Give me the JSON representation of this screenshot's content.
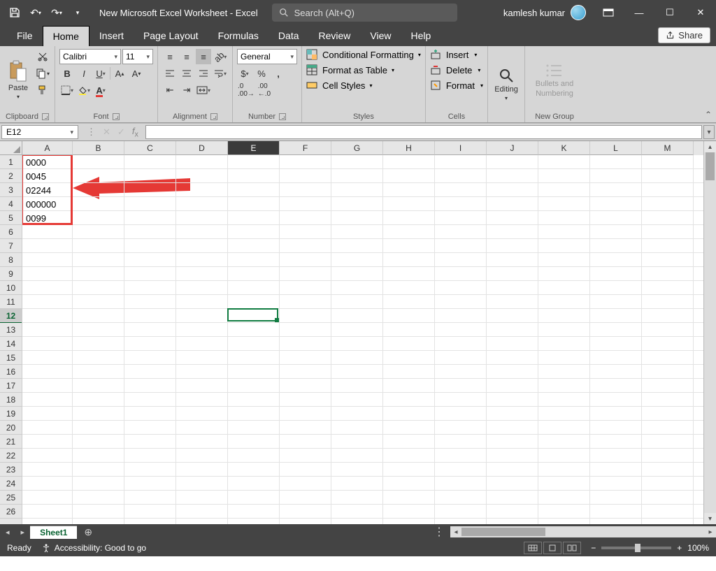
{
  "titlebar": {
    "title": "New Microsoft Excel Worksheet  -  Excel",
    "search_placeholder": "Search (Alt+Q)",
    "user": "kamlesh kumar"
  },
  "tabs": [
    "File",
    "Home",
    "Insert",
    "Page Layout",
    "Formulas",
    "Data",
    "Review",
    "View",
    "Help"
  ],
  "active_tab": "Home",
  "share_label": "Share",
  "ribbon": {
    "clipboard": {
      "paste": "Paste",
      "label": "Clipboard"
    },
    "font": {
      "name": "Calibri",
      "size": "11",
      "label": "Font"
    },
    "alignment": {
      "label": "Alignment"
    },
    "number": {
      "format": "General",
      "label": "Number"
    },
    "styles": {
      "cond": "Conditional Formatting",
      "table": "Format as Table",
      "cell": "Cell Styles",
      "label": "Styles"
    },
    "cells": {
      "insert": "Insert",
      "delete": "Delete",
      "format": "Format",
      "label": "Cells"
    },
    "editing": {
      "label": "Editing"
    },
    "newgroup": {
      "line1": "Bullets and",
      "line2": "Numbering",
      "label": "New Group"
    }
  },
  "namebox": "E12",
  "columns": [
    {
      "l": "A",
      "w": 72
    },
    {
      "l": "B",
      "w": 74
    },
    {
      "l": "C",
      "w": 74
    },
    {
      "l": "D",
      "w": 74
    },
    {
      "l": "E",
      "w": 74
    },
    {
      "l": "F",
      "w": 74
    },
    {
      "l": "G",
      "w": 74
    },
    {
      "l": "H",
      "w": 74
    },
    {
      "l": "I",
      "w": 74
    },
    {
      "l": "J",
      "w": 74
    },
    {
      "l": "K",
      "w": 74
    },
    {
      "l": "L",
      "w": 74
    },
    {
      "l": "M",
      "w": 74
    }
  ],
  "row_count": 26,
  "active_col_index": 4,
  "active_row_index": 11,
  "cells": [
    {
      "r": 0,
      "c": 0,
      "v": "0000"
    },
    {
      "r": 1,
      "c": 0,
      "v": "0045"
    },
    {
      "r": 2,
      "c": 0,
      "v": "02244"
    },
    {
      "r": 3,
      "c": 0,
      "v": "000000"
    },
    {
      "r": 4,
      "c": 0,
      "v": "0099"
    }
  ],
  "sheet": {
    "name": "Sheet1"
  },
  "status": {
    "ready": "Ready",
    "accessibility": "Accessibility: Good to go",
    "zoom": "100%"
  }
}
